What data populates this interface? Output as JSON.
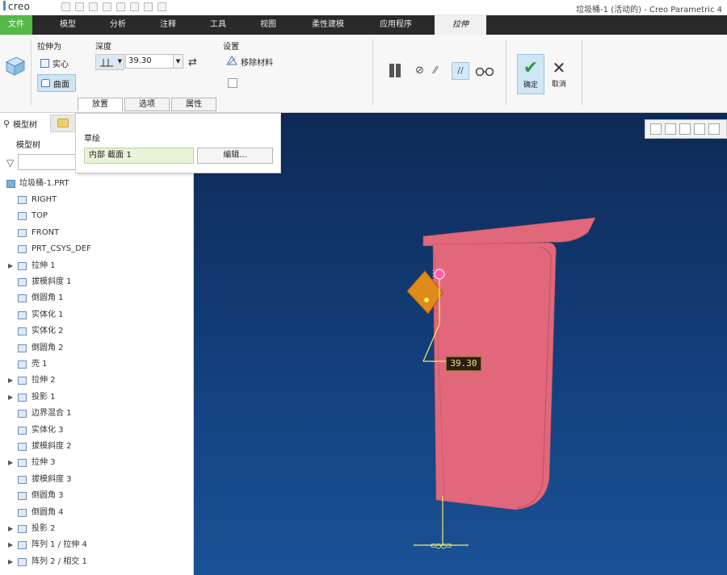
{
  "titlebar": {
    "logo": "creo",
    "window_title": "垃圾桶-1 (活动的) - Creo Parametric 4"
  },
  "menubar": {
    "items": [
      "文件",
      "模型",
      "分析",
      "注释",
      "工具",
      "视图",
      "柔性建模",
      "应用程序",
      "拉伸"
    ]
  },
  "ribbon": {
    "extrude_as": {
      "label": "拉伸为",
      "solid": "实心",
      "surface": "曲面"
    },
    "depth": {
      "label": "深度",
      "value": "39.30"
    },
    "settings": {
      "label": "设置",
      "remove_material": "移除材料"
    },
    "ok_label": "确定",
    "cancel_label": "取消",
    "subtabs": [
      "放置",
      "选项",
      "属性"
    ]
  },
  "placement": {
    "sketch_label": "草绘",
    "sketch_value": "内部 截面 1",
    "edit_label": "编辑..."
  },
  "sidebar": {
    "tab_label": "模型树",
    "tree_header": "模型树",
    "root": "垃圾桶-1.PRT",
    "items": [
      {
        "label": "RIGHT",
        "expandable": false
      },
      {
        "label": "TOP",
        "expandable": false
      },
      {
        "label": "FRONT",
        "expandable": false
      },
      {
        "label": "PRT_CSYS_DEF",
        "expandable": false
      },
      {
        "label": "拉伸 1",
        "expandable": true
      },
      {
        "label": "拔模斜度 1",
        "expandable": false
      },
      {
        "label": "倒圆角 1",
        "expandable": false
      },
      {
        "label": "实体化 1",
        "expandable": false
      },
      {
        "label": "实体化 2",
        "expandable": false
      },
      {
        "label": "倒圆角 2",
        "expandable": false
      },
      {
        "label": "壳 1",
        "expandable": false
      },
      {
        "label": "拉伸 2",
        "expandable": true
      },
      {
        "label": "投影 1",
        "expandable": true
      },
      {
        "label": "边界混合 1",
        "expandable": false
      },
      {
        "label": "实体化 3",
        "expandable": false
      },
      {
        "label": "拔模斜度 2",
        "expandable": false
      },
      {
        "label": "拉伸 3",
        "expandable": true
      },
      {
        "label": "拔模斜度 3",
        "expandable": false
      },
      {
        "label": "倒圆角 3",
        "expandable": false
      },
      {
        "label": "倒圆角 4",
        "expandable": false
      },
      {
        "label": "投影 2",
        "expandable": true
      },
      {
        "label": "阵列 1 / 拉伸 4",
        "expandable": true
      },
      {
        "label": "阵列 2 / 相交 1",
        "expandable": true
      }
    ]
  },
  "viewport": {
    "dimension_value": "39.30",
    "colors": {
      "part": "#e0687a",
      "background": "#123d79"
    }
  }
}
